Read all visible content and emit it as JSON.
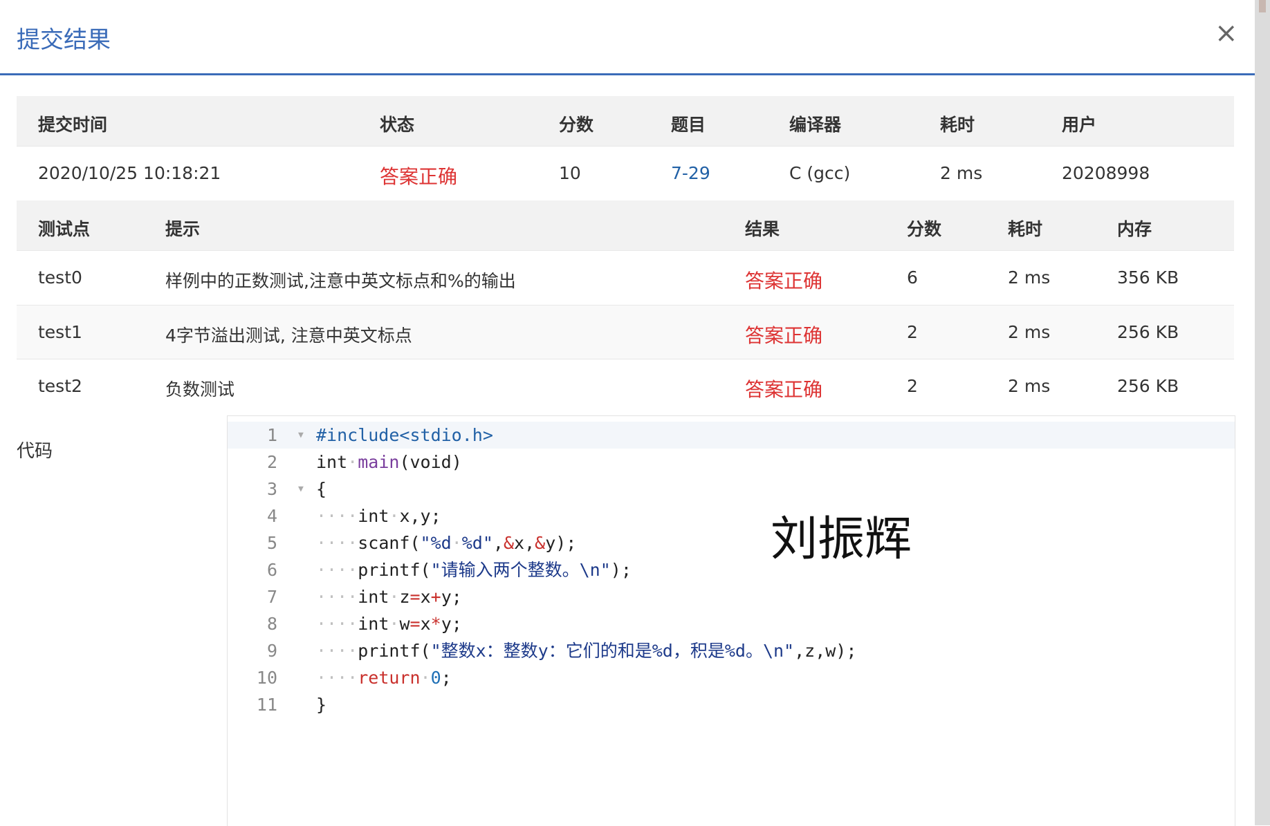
{
  "modal": {
    "title": "提交结果",
    "close_icon": "×"
  },
  "submission": {
    "headers": [
      "提交时间",
      "状态",
      "分数",
      "题目",
      "编译器",
      "耗时",
      "用户"
    ],
    "row": {
      "time": "2020/10/25 10:18:21",
      "status": "答案正确",
      "score": "10",
      "problem": "7-29",
      "compiler": "C (gcc)",
      "duration": "2 ms",
      "user": "20208998"
    }
  },
  "tests": {
    "headers": [
      "测试点",
      "提示",
      "结果",
      "分数",
      "耗时",
      "内存"
    ],
    "rows": [
      {
        "id": "test0",
        "hint": "样例中的正数测试,注意中英文标点和%的输出",
        "result": "答案正确",
        "score": "6",
        "time": "2 ms",
        "memory": "356 KB"
      },
      {
        "id": "test1",
        "hint": "4字节溢出测试, 注意中英文标点",
        "result": "答案正确",
        "score": "2",
        "time": "2 ms",
        "memory": "256 KB"
      },
      {
        "id": "test2",
        "hint": "负数测试",
        "result": "答案正确",
        "score": "2",
        "time": "2 ms",
        "memory": "256 KB"
      }
    ]
  },
  "code": {
    "label": "代码",
    "lines": [
      "#include<stdio.h>",
      "int main(void)",
      "{",
      "    int x,y;",
      "    scanf(\"%d %d\",&x,&y);",
      "    printf(\"请输入两个整数。\\n\");",
      "    int z=x+y;",
      "    int w=x*y;",
      "    printf(\"整数x：整数y：它们的和是%d，积是%d。\\n\",z,w);",
      "    return 0;",
      "}"
    ]
  },
  "watermark": "刘振辉",
  "colors": {
    "accent": "#3a6bb8",
    "status_ok": "#dd3333",
    "link": "#2261a6"
  }
}
